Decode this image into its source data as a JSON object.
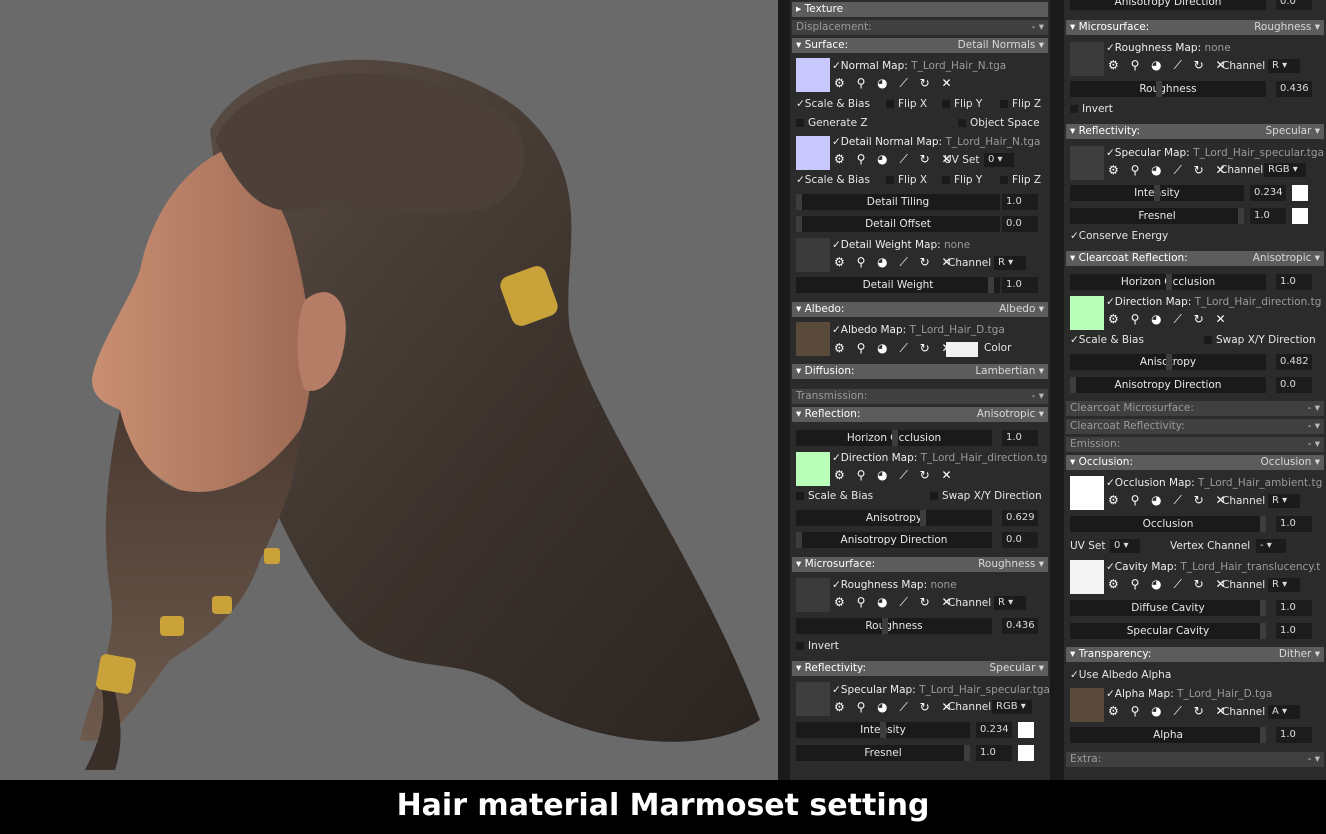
{
  "caption": "Hair material Marmoset setting",
  "colors": {
    "panel": "#2b2b2b",
    "header": "#5c5c5c",
    "normal_swatch": "#c8c8ff",
    "direction_swatch": "#b9ffb9"
  },
  "icons": [
    "gear-icon",
    "search-icon",
    "eyedropper-icon",
    "pen-icon",
    "refresh-icon",
    "close-icon"
  ],
  "tool_glyphs": "⚙ ⚲ ◕ ⟋ ↻ ✕",
  "col1": {
    "texture": "Texture",
    "displacement": {
      "label": "Displacement:",
      "value": "- ▾"
    },
    "surface": {
      "label": "Surface:",
      "value": "Detail Normals ▾"
    },
    "normal_map": {
      "label": "✓Normal Map:",
      "file": "T_Lord_Hair_N.tga"
    },
    "row_scale1": {
      "scale": "✓Scale & Bias",
      "flipx": "Flip X",
      "flipy": "Flip Y",
      "flipz": "Flip Z"
    },
    "generate_z": "Generate Z",
    "object_space": "Object Space",
    "detail_normal_map": {
      "label": "✓Detail Normal Map:",
      "file": "T_Lord_Hair_N.tga",
      "uvset": "UV Set",
      "uv_value": "0 ▾"
    },
    "row_scale2": {
      "scale": "✓Scale & Bias",
      "flipx": "Flip X",
      "flipy": "Flip Y",
      "flipz": "Flip Z"
    },
    "detail_tiling": {
      "label": "Detail Tiling",
      "value": "1.0"
    },
    "detail_offset": {
      "label": "Detail Offset",
      "value": "0.0"
    },
    "detail_weight_map": {
      "label": "✓Detail Weight Map:",
      "file": "none",
      "channel": "Channel",
      "channel_value": "R ▾"
    },
    "detail_weight": {
      "label": "Detail Weight",
      "value": "1.0"
    },
    "albedo": {
      "label": "Albedo:",
      "value": "Albedo ▾"
    },
    "albedo_map": {
      "label": "✓Albedo Map:",
      "file": "T_Lord_Hair_D.tga",
      "color": "Color"
    },
    "diffusion": {
      "label": "Diffusion:",
      "value": "Lambertian ▾"
    },
    "transmission": {
      "label": "Transmission:",
      "value": "- ▾"
    },
    "reflection": {
      "label": "Reflection:",
      "value": "Anisotropic ▾"
    },
    "horizon_occlusion": {
      "label": "Horizon Occlusion",
      "value": "1.0"
    },
    "direction_map": {
      "label": "✓Direction Map:",
      "file": "T_Lord_Hair_direction.tg"
    },
    "scale_bias": "Scale & Bias",
    "swap_xy": "Swap X/Y Direction",
    "anisotropy": {
      "label": "Anisotropy",
      "value": "0.629"
    },
    "anisotropy_direction": {
      "label": "Anisotropy Direction",
      "value": "0.0"
    },
    "microsurface": {
      "label": "Microsurface:",
      "value": "Roughness ▾"
    },
    "roughness_map": {
      "label": "✓Roughness Map:",
      "file": "none",
      "channel": "Channel",
      "channel_value": "R ▾"
    },
    "roughness": {
      "label": "Roughness",
      "value": "0.436"
    },
    "invert": "Invert",
    "reflectivity": {
      "label": "Reflectivity:",
      "value": "Specular ▾"
    },
    "specular_map": {
      "label": "✓Specular Map:",
      "file": "T_Lord_Hair_specular.tga",
      "channel": "Channel",
      "channel_value": "RGB ▾"
    },
    "intensity": {
      "label": "Intensity",
      "value": "0.234"
    },
    "fresnel": {
      "label": "Fresnel",
      "value": "1.0"
    }
  },
  "col2": {
    "aniso_dir_top": {
      "label": "Anisotropy Direction",
      "value": "0.0"
    },
    "microsurface": {
      "label": "Microsurface:",
      "value": "Roughness ▾"
    },
    "roughness_map": {
      "label": "✓Roughness Map:",
      "file": "none",
      "channel": "Channel",
      "channel_value": "R ▾"
    },
    "roughness": {
      "label": "Roughness",
      "value": "0.436"
    },
    "invert": "Invert",
    "reflectivity": {
      "label": "Reflectivity:",
      "value": "Specular ▾"
    },
    "specular_map": {
      "label": "✓Specular Map:",
      "file": "T_Lord_Hair_specular.tga",
      "channel": "Channel",
      "channel_value": "RGB ▾"
    },
    "intensity": {
      "label": "Intensity",
      "value": "0.234"
    },
    "fresnel": {
      "label": "Fresnel",
      "value": "1.0"
    },
    "conserve_energy": "✓Conserve Energy",
    "clearcoat_reflection": {
      "label": "Clearcoat Reflection:",
      "value": "Anisotropic ▾"
    },
    "horizon_occlusion": {
      "label": "Horizon Occlusion",
      "value": "1.0"
    },
    "direction_map": {
      "label": "✓Direction Map:",
      "file": "T_Lord_Hair_direction.tg"
    },
    "scale_bias": "✓Scale & Bias",
    "swap_xy": "Swap X/Y Direction",
    "anisotropy": {
      "label": "Anisotropy",
      "value": "0.482"
    },
    "anisotropy_direction": {
      "label": "Anisotropy Direction",
      "value": "0.0"
    },
    "clearcoat_microsurface": {
      "label": "Clearcoat Microsurface:",
      "value": "- ▾"
    },
    "clearcoat_reflectivity": {
      "label": "Clearcoat Reflectivity:",
      "value": "- ▾"
    },
    "emission": {
      "label": "Emission:",
      "value": "- ▾"
    },
    "occlusion": {
      "label": "Occlusion:",
      "value": "Occlusion ▾"
    },
    "occlusion_map": {
      "label": "✓Occlusion Map:",
      "file": "T_Lord_Hair_ambient.tg",
      "channel": "Channel",
      "channel_value": "R ▾"
    },
    "occlusion_slider": {
      "label": "Occlusion",
      "value": "1.0"
    },
    "uvset": "UV Set",
    "uv_value": "0 ▾",
    "vertex_channel": "Vertex Channel",
    "vertex_value": "- ▾",
    "cavity_map": {
      "label": "✓Cavity Map:",
      "file": "T_Lord_Hair_translucency.t",
      "channel": "Channel",
      "channel_value": "R ▾"
    },
    "diffuse_cavity": {
      "label": "Diffuse Cavity",
      "value": "1.0"
    },
    "specular_cavity": {
      "label": "Specular Cavity",
      "value": "1.0"
    },
    "transparency": {
      "label": "Transparency:",
      "value": "Dither ▾"
    },
    "use_albedo_alpha": "✓Use Albedo Alpha",
    "alpha_map": {
      "label": "✓Alpha Map:",
      "file": "T_Lord_Hair_D.tga",
      "channel": "Channel",
      "channel_value": "A ▾"
    },
    "alpha": {
      "label": "Alpha",
      "value": "1.0"
    },
    "extra": {
      "label": "Extra:",
      "value": "- ▾"
    }
  }
}
